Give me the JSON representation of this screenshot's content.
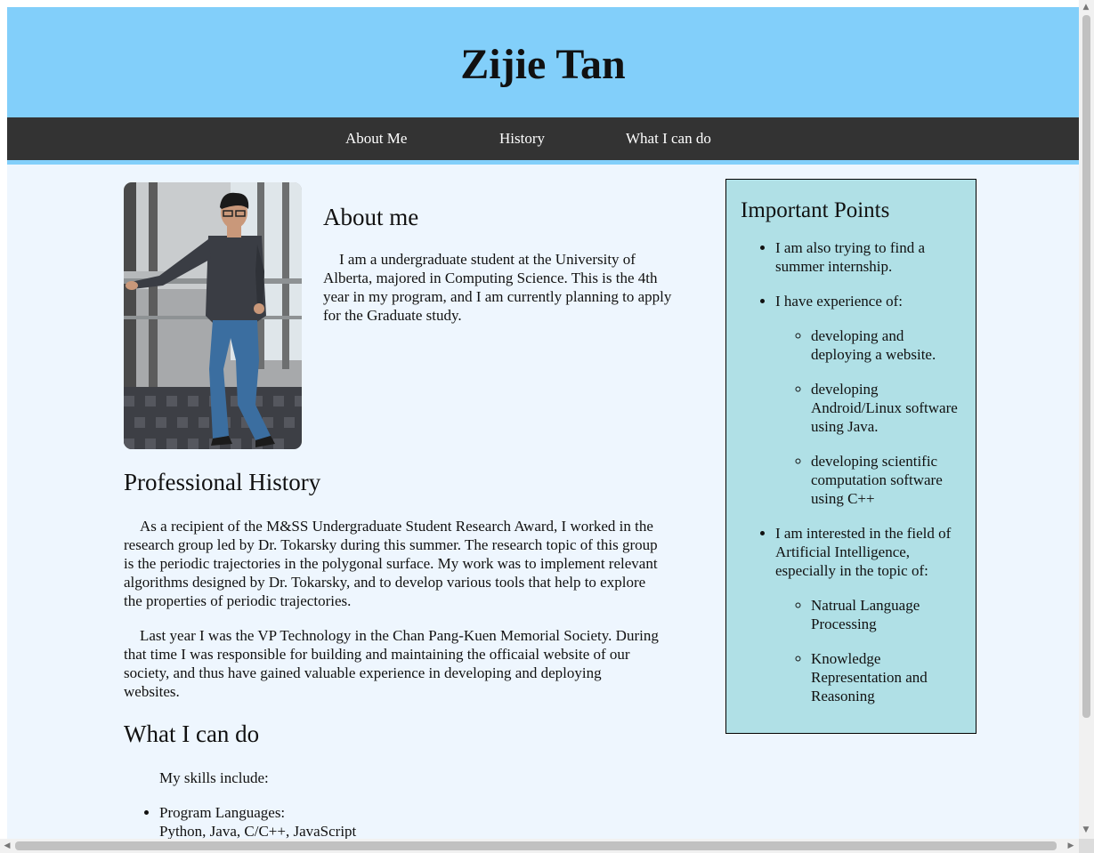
{
  "header": {
    "title": "Zijie Tan"
  },
  "nav": [
    {
      "label": "About Me"
    },
    {
      "label": "History"
    },
    {
      "label": "What I can do"
    }
  ],
  "about": {
    "heading": "About me",
    "text": "I am a undergraduate student at the University of Alberta, majored in Computing Science. This is the 4th year in my program, and I am currently planning to apply for the Graduate study."
  },
  "history": {
    "heading": "Professional History",
    "paragraphs": [
      "As a recipient of the M&SS Undergraduate Student Research Award, I worked in the research group led by Dr. Tokarsky during this summer. The research topic of this group is the periodic trajectories in the polygonal surface. My work was to implement relevant algorithms designed by Dr. Tokarsky, and to develop various tools that help to explore the properties of periodic trajectories.",
      "Last year I was the VP Technology in the Chan Pang-Kuen Memorial Society. During that time I was responsible for building and maintaining the officaial website of our society, and thus have gained valuable experience in developing and deploying websites."
    ]
  },
  "skills": {
    "heading": "What I can do",
    "intro": "My skills include:",
    "items": [
      {
        "label": "Program Languages:",
        "detail": "Python, Java, C/C++, JavaScript"
      }
    ]
  },
  "aside": {
    "heading": "Important Points",
    "points": [
      {
        "text": "I am also trying to find a summer internship.",
        "sub": []
      },
      {
        "text": "I have experience of:",
        "sub": [
          "developing and deploying a website.",
          "developing Android/Linux software using Java.",
          "developing scientific computation software using C++"
        ]
      },
      {
        "text": "I am interested in the field of Artificial Intelligence, especially in the topic of:",
        "sub": [
          "Natrual Language Processing",
          "Knowledge Representation and Reasoning"
        ]
      }
    ]
  },
  "colors": {
    "header_bg": "#82cffa",
    "nav_bg": "#333333",
    "page_bg": "#eef6fe",
    "aside_bg": "#b0e0e6"
  }
}
